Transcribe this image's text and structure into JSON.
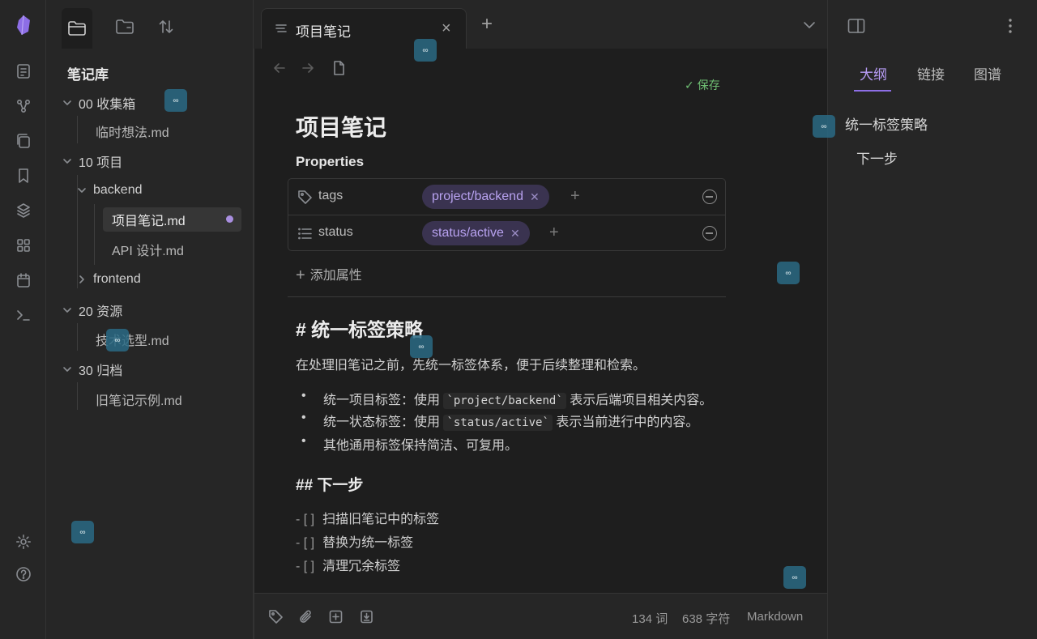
{
  "sidebar": {
    "vault_title": "笔记库",
    "tree": [
      {
        "label": "00 收集箱",
        "type": "folder"
      },
      {
        "label": "临时想法.md",
        "type": "file"
      },
      {
        "label": "10 项目",
        "type": "folder"
      },
      {
        "label": "backend",
        "type": "folder"
      },
      {
        "label": "项目笔记.md",
        "type": "file",
        "selected": true
      },
      {
        "label": "API 设计.md",
        "type": "file"
      },
      {
        "label": "frontend",
        "type": "folder",
        "collapsed": true
      },
      {
        "label": "20 资源",
        "type": "folder"
      },
      {
        "label": "技术选型.md",
        "type": "file"
      },
      {
        "label": "30 归档",
        "type": "folder"
      },
      {
        "label": "旧笔记示例.md",
        "type": "file"
      }
    ]
  },
  "tab": {
    "title": "项目笔记",
    "close": "×",
    "new_tab": "+"
  },
  "editor": {
    "saved_label": "保存",
    "title": "项目笔记",
    "properties_heading": "Properties",
    "properties": [
      {
        "key": "tags",
        "value": "project/backend"
      },
      {
        "key": "status",
        "value": "status/active"
      }
    ],
    "add_property": "添加属性",
    "h1": "# 统一标签策略",
    "paragraph": "在处理旧笔记之前，先统一标签体系，便于后续整理和检索。",
    "bullets": [
      {
        "before": "统一项目标签：使用 ",
        "code": "`project/backend`",
        "after": " 表示后端项目相关内容。"
      },
      {
        "before": "统一状态标签：使用 ",
        "code": "`status/active`",
        "after": " 表示当前进行中的内容。"
      },
      {
        "before": "其他通用标签保持简洁、可复用。",
        "code": "",
        "after": ""
      }
    ],
    "h2": "## 下一步",
    "tasks": [
      {
        "box": "- [ ]",
        "text": "扫描旧笔记中的标签"
      },
      {
        "box": "- [ ]",
        "text": "替换为统一标签"
      },
      {
        "box": "- [ ]",
        "text": "清理冗余标签"
      }
    ]
  },
  "statusbar": {
    "words": "134 词",
    "chars": "638 字符",
    "mode": "Markdown"
  },
  "right_panel": {
    "tabs": [
      "大纲",
      "链接",
      "图谱"
    ],
    "outline": [
      "统一标签策略",
      "下一步"
    ]
  },
  "colors": {
    "accent": "#8d6ee6",
    "tag_bg": "#3a3350",
    "tag_text": "#b8a2f0",
    "saved": "#6fbf73"
  }
}
